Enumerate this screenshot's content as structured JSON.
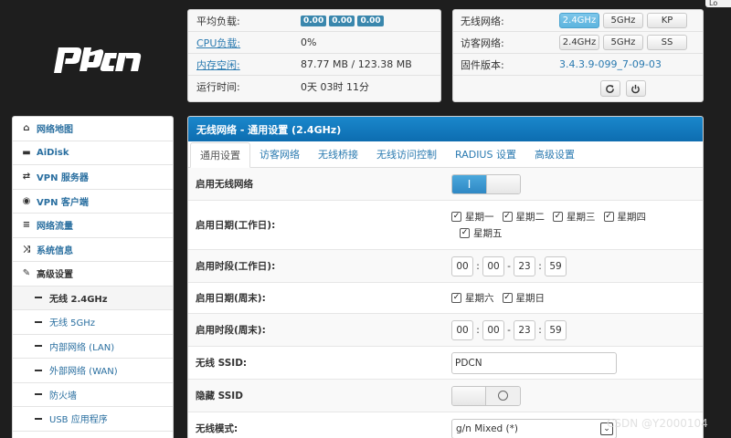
{
  "top_bar": {
    "login_label": "Lo"
  },
  "status": {
    "load_label": "平均负载:",
    "load_values": [
      "0.00",
      "0.00",
      "0.00"
    ],
    "cpu_label": "CPU负载:",
    "cpu_value": "0%",
    "mem_label": "内存空闲:",
    "mem_value": "87.77 MB / 123.38 MB",
    "uptime_label": "运行时间:",
    "uptime_value": "0天 03时 11分"
  },
  "wifi_status": {
    "wireless_label": "无线网络:",
    "wireless_buttons": [
      "2.4GHz",
      "5GHz",
      "KP"
    ],
    "guest_label": "访客网络:",
    "guest_buttons": [
      "2.4GHz",
      "5GHz",
      "SS"
    ],
    "firmware_label": "固件版本:",
    "firmware_value": "3.4.3.9-099_7-09-03",
    "refresh_icon": "refresh-icon",
    "power_icon": "power-icon"
  },
  "sidebar": {
    "items": [
      {
        "label": "网络地图",
        "icon": "home-icon"
      },
      {
        "label": "AiDisk",
        "icon": "hdd-icon"
      },
      {
        "label": "VPN 服务器",
        "icon": "retweet-icon"
      },
      {
        "label": "VPN 客户端",
        "icon": "globe-icon"
      },
      {
        "label": "网络流量",
        "icon": "list-icon"
      },
      {
        "label": "系统信息",
        "icon": "shuffle-icon"
      },
      {
        "label": "高级设置",
        "icon": "wrench-icon"
      }
    ],
    "subitems": [
      {
        "label": "无线 2.4GHz"
      },
      {
        "label": "无线 5GHz"
      },
      {
        "label": "内部网络 (LAN)"
      },
      {
        "label": "外部网络 (WAN)"
      },
      {
        "label": "防火墙"
      },
      {
        "label": "USB 应用程序"
      }
    ]
  },
  "main": {
    "title": "无线网络 - 通用设置 (2.4GHz)",
    "tabs": [
      "通用设置",
      "访客网络",
      "无线桥接",
      "无线访问控制",
      "RADIUS 设置",
      "高级设置"
    ],
    "enable_label": "启用无线网络",
    "enable_on_text": "I",
    "weekday_days_label": "启用日期(工作日):",
    "weekday_days": [
      "星期一",
      "星期二",
      "星期三",
      "星期四",
      "星期五"
    ],
    "weekday_time_label": "启用时段(工作日):",
    "weekday_time": [
      "00",
      "00",
      "23",
      "59"
    ],
    "weekend_days_label": "启用日期(周末):",
    "weekend_days": [
      "星期六",
      "星期日"
    ],
    "weekend_time_label": "启用时段(周末):",
    "weekend_time": [
      "00",
      "00",
      "23",
      "59"
    ],
    "ssid_label": "无线 SSID:",
    "ssid_value": "PDCN",
    "hide_ssid_label": "隐藏 SSID",
    "mode_label": "无线模式:",
    "mode_value": "g/n Mixed (*)"
  },
  "watermark": "CSDN @Y2000104",
  "colors": {
    "accent": "#1a88cc",
    "active_pill": "#5db4de",
    "badge": "#3a87ad"
  }
}
